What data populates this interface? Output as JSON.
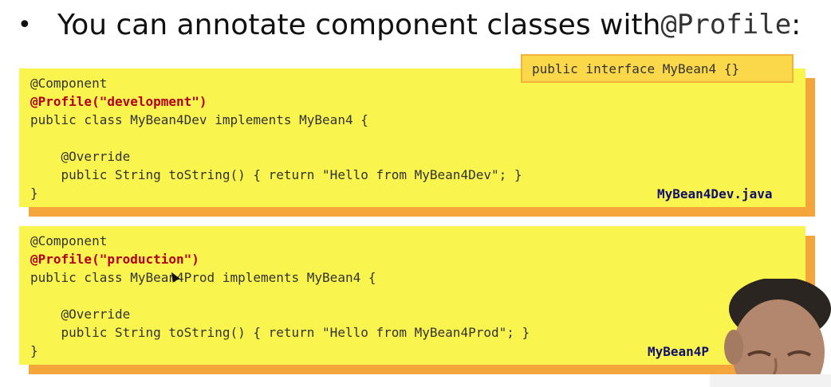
{
  "heading": {
    "bullet": "•",
    "text": "You can annotate component classes with ",
    "code": "@Profile",
    "suffix": ":"
  },
  "interface_box": "public interface MyBean4 {}",
  "panels": [
    {
      "lines": [
        "@Component",
        "@Profile(\"development\")",
        "public class MyBean4Dev implements MyBean4 {",
        "",
        "    @Override",
        "    public String toString() { return \"Hello from MyBean4Dev\"; }",
        "}"
      ],
      "filename": "MyBean4Dev.java"
    },
    {
      "lines": [
        "@Component",
        "@Profile(\"production\")",
        "public class MyBean4Prod implements MyBean4 {",
        "",
        "    @Override",
        "    public String toString() { return \"Hello from MyBean4Prod\"; }",
        "}"
      ],
      "filename": "MyBean4P"
    }
  ],
  "colors": {
    "panel": "#faf44e",
    "shadow": "#f5a63a",
    "profile_annotation": "#b3001b",
    "filename": "#10106a"
  }
}
